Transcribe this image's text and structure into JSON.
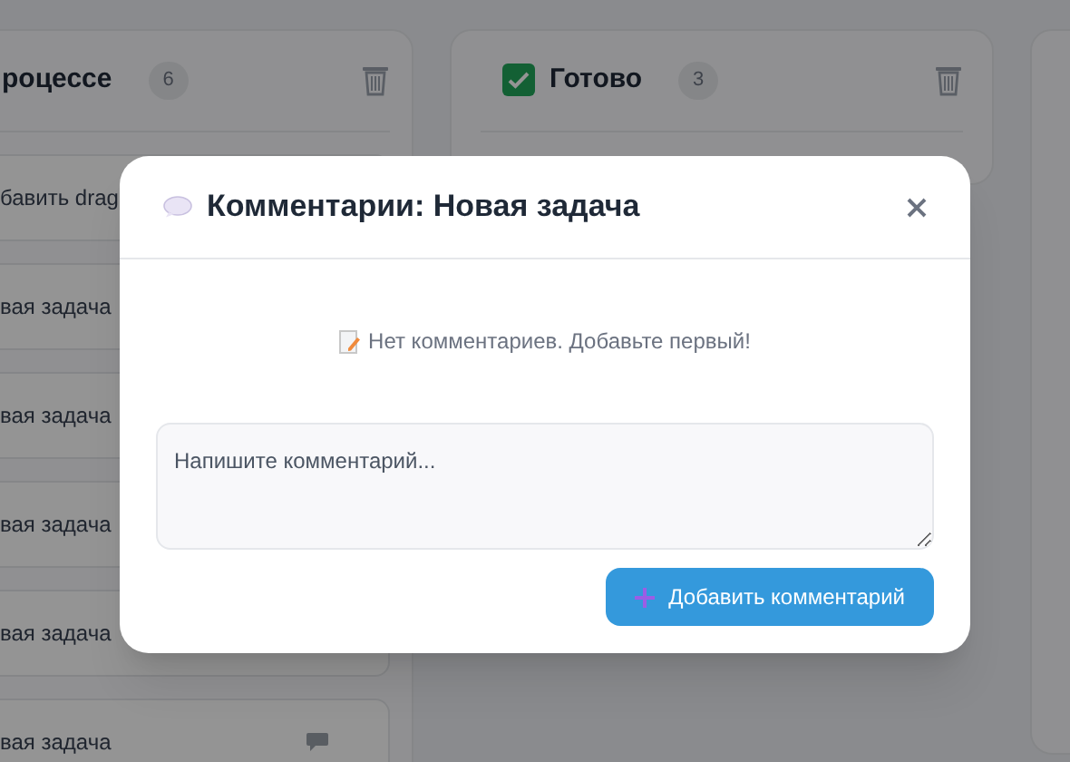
{
  "board": {
    "columns": [
      {
        "title": "роцессе",
        "count": "6",
        "done": false,
        "cards": [
          {
            "title": "бавить drag",
            "has_comments": false
          },
          {
            "title": "вая задача",
            "has_comments": false
          },
          {
            "title": "вая задача",
            "has_comments": false
          },
          {
            "title": "вая задача",
            "has_comments": false
          },
          {
            "title": "вая задача",
            "has_comments": false
          },
          {
            "title": "вая задача",
            "has_comments": true
          }
        ]
      },
      {
        "title": "Готово",
        "count": "3",
        "done": true
      }
    ]
  },
  "dialog": {
    "title": "Комментарии: Новая задача",
    "empty_text": "Нет комментариев. Добавьте первый!",
    "input": {
      "placeholder": "Напишите комментарий..."
    },
    "submit_button": "Добавить комментарий"
  }
}
